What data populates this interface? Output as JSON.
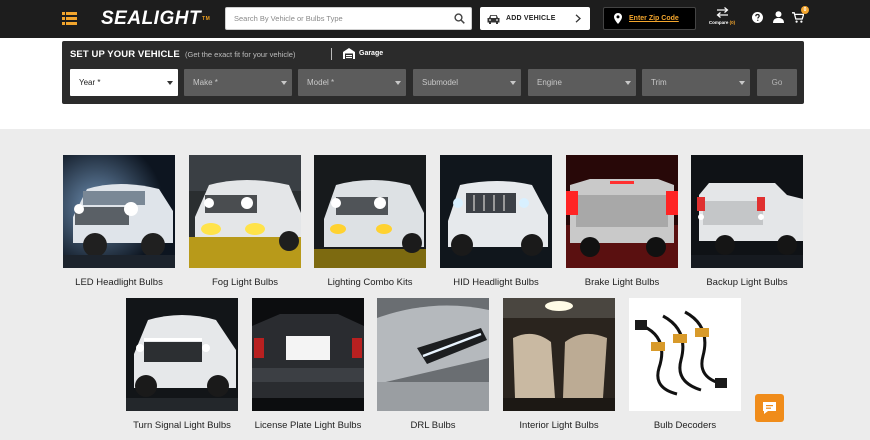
{
  "header": {
    "logo_text": "SEALIGHT",
    "logo_mark": "TM",
    "search_placeholder": "Search By Vehicle or Bulbs Type",
    "add_vehicle_label": "ADD VEHICLE",
    "zip_label": "Enter Zip Code",
    "compare_label": "Compare",
    "compare_count": "(0)",
    "cart_count": "0",
    "icons": [
      "menu-icon",
      "search-icon",
      "car-icon",
      "chevron-right-icon",
      "location-pin-icon",
      "compare-arrows-icon",
      "help-icon",
      "user-icon",
      "cart-icon"
    ]
  },
  "vehicle": {
    "title": "SET UP YOUR VEHICLE",
    "subtitle": "(Get the exact fit for your vehicle)",
    "garage_label": "Garage",
    "selects": [
      "Year *",
      "Make *",
      "Model *",
      "Submodel",
      "Engine",
      "Trim"
    ],
    "go_label": "Go"
  },
  "categories": [
    "LED Headlight Bulbs",
    "Fog Light Bulbs",
    "Lighting Combo Kits",
    "HID Headlight Bulbs",
    "Brake Light Bulbs",
    "Backup Light Bulbs",
    "Turn Signal Light Bulbs",
    "License Plate Light Bulbs",
    "DRL Bulbs",
    "Interior Light Bulbs",
    "Bulb Decoders"
  ],
  "colors": {
    "topbar": "#1d1d1d",
    "accent": "#f2a52d",
    "panel": "#2b2b2b",
    "page_bg": "#ececec",
    "chat_button": "#f08c1a"
  }
}
